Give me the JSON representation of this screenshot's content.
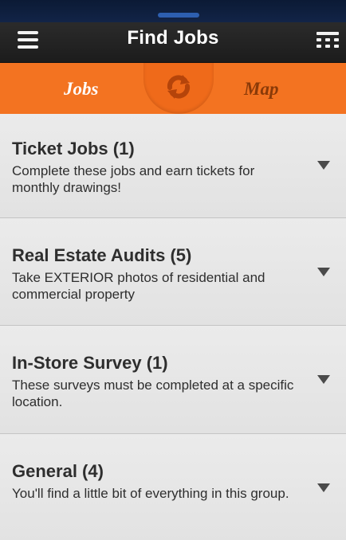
{
  "navbar": {
    "title": "Find Jobs",
    "menu_icon": "hamburger-menu-icon",
    "grid_icon": "grid-menu-icon"
  },
  "tabs": {
    "jobs_label": "Jobs",
    "map_label": "Map",
    "active": "Jobs",
    "refresh_icon": "refresh-icon"
  },
  "colors": {
    "accent": "#f37321",
    "navbar": "#1f1f1f",
    "list_bg": "#e6e6e6"
  },
  "categories": [
    {
      "title": "Ticket Jobs (1)",
      "description": "Complete these jobs and earn tickets for monthly drawings!"
    },
    {
      "title": "Real Estate Audits (5)",
      "description": "Take EXTERIOR photos of residential and commercial property"
    },
    {
      "title": "In-Store Survey (1)",
      "description": "These surveys must be completed at a specific location."
    },
    {
      "title": "General (4)",
      "description": "You'll find a little bit of everything in this group."
    }
  ]
}
